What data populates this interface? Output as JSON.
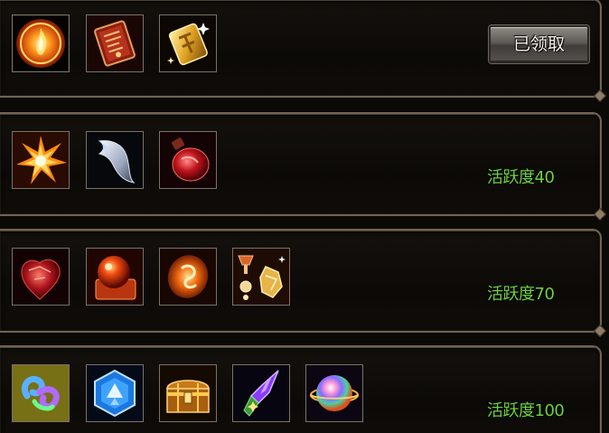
{
  "reward_rows": [
    {
      "status_button_label": "已领取",
      "items": [
        {
          "icon": "fire-orb-icon"
        },
        {
          "icon": "scroll-book-icon"
        },
        {
          "icon": "gold-tablet-icon"
        }
      ]
    },
    {
      "activity_label": "活跃度40",
      "items": [
        {
          "icon": "flame-burst-icon"
        },
        {
          "icon": "silver-fang-icon"
        },
        {
          "icon": "red-potion-icon"
        }
      ]
    },
    {
      "activity_label": "活跃度70",
      "items": [
        {
          "icon": "red-gem-icon"
        },
        {
          "icon": "red-orb-icon"
        },
        {
          "icon": "fire-rune-icon"
        },
        {
          "icon": "gold-pills-icon"
        }
      ]
    },
    {
      "activity_label": "活跃度100",
      "items": [
        {
          "icon": "rainbow-ring-icon"
        },
        {
          "icon": "blue-crystal-icon"
        },
        {
          "icon": "treasure-chest-icon"
        },
        {
          "icon": "purple-crystal-icon"
        },
        {
          "icon": "rainbow-sphere-icon"
        }
      ]
    }
  ],
  "colors": {
    "activity_text": "#6fd13f",
    "panel_border": "#6f6452"
  }
}
